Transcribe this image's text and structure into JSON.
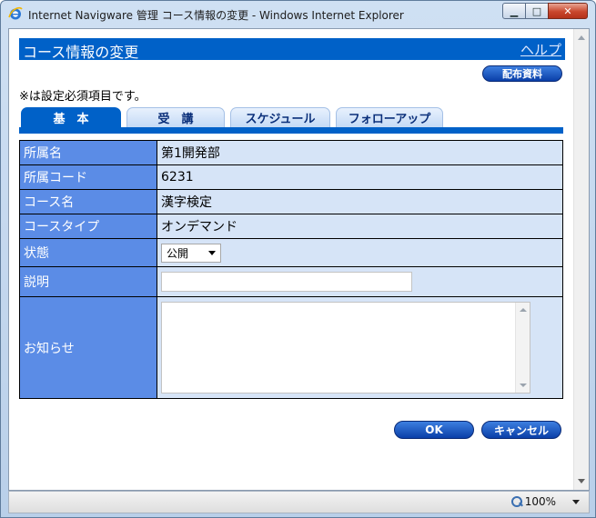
{
  "window": {
    "title": "Internet Navigware 管理 コース情報の変更 - Windows Internet Explorer",
    "min_glyph": "▁",
    "max_glyph": "□",
    "close_glyph": "✕"
  },
  "page": {
    "title": "コース情報の変更",
    "help_link": "ヘルプ",
    "handout_button": "配布資料",
    "required_note": "※は設定必須項目です。"
  },
  "tabs": [
    {
      "label": "基　本",
      "active": true
    },
    {
      "label": "受　講",
      "active": false
    },
    {
      "label": "スケジュール",
      "active": false
    },
    {
      "label": "フォローアップ",
      "active": false
    }
  ],
  "form": {
    "affiliation_name": {
      "label": "所属名",
      "value": "第1開発部"
    },
    "affiliation_code": {
      "label": "所属コード",
      "value": "6231"
    },
    "course_name": {
      "label": "コース名",
      "value": "漢字検定"
    },
    "course_type": {
      "label": "コースタイプ",
      "value": "オンデマンド"
    },
    "status": {
      "label": "状態",
      "selected": "公開"
    },
    "description": {
      "label": "説明",
      "value": ""
    },
    "notice": {
      "label": "お知らせ",
      "value": ""
    }
  },
  "buttons": {
    "ok": "OK",
    "cancel": "キャンセル"
  },
  "statusbar": {
    "zoom": "100%"
  },
  "colors": {
    "header_blue": "#0061c8",
    "label_cell": "#5b8ce6",
    "value_cell": "#d6e4f7"
  }
}
